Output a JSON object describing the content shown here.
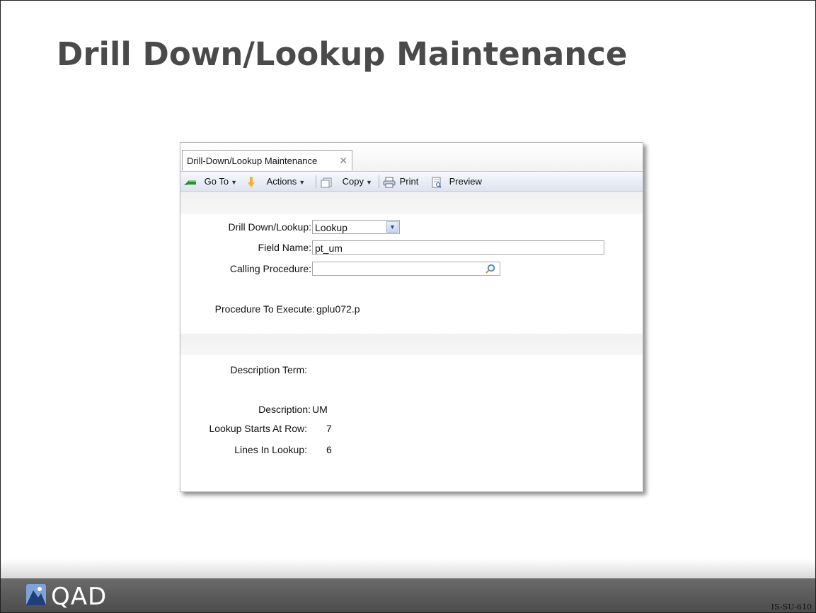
{
  "slide": {
    "title": "Drill Down/Lookup Maintenance",
    "code": "IS-SU-610"
  },
  "window": {
    "tab_label": "Drill-Down/Lookup Maintenance",
    "toolbar": {
      "goto_label": "Go To",
      "actions_label": "Actions",
      "copy_label": "Copy",
      "print_label": "Print",
      "preview_label": "Preview"
    },
    "form": {
      "drill_down_lookup_label": "Drill Down/Lookup:",
      "drill_down_lookup_value": "Lookup",
      "field_name_label": "Field Name:",
      "field_name_value": "pt_um",
      "calling_procedure_label": "Calling Procedure:",
      "calling_procedure_value": "",
      "procedure_to_execute_label": "Procedure To Execute:",
      "procedure_to_execute_value": "gplu072.p",
      "description_term_label": "Description Term:",
      "description_label": "Description:",
      "description_value": "UM",
      "lookup_starts_label": "Lookup Starts At Row:",
      "lookup_starts_value": "7",
      "lines_in_lookup_label": "Lines In Lookup:",
      "lines_in_lookup_value": "6"
    }
  },
  "brand": {
    "logo_text": "QAD"
  },
  "colors": {
    "title": "#4a4a4a",
    "footer": "#5a5a5a",
    "toolbar": "#dde3ef"
  }
}
